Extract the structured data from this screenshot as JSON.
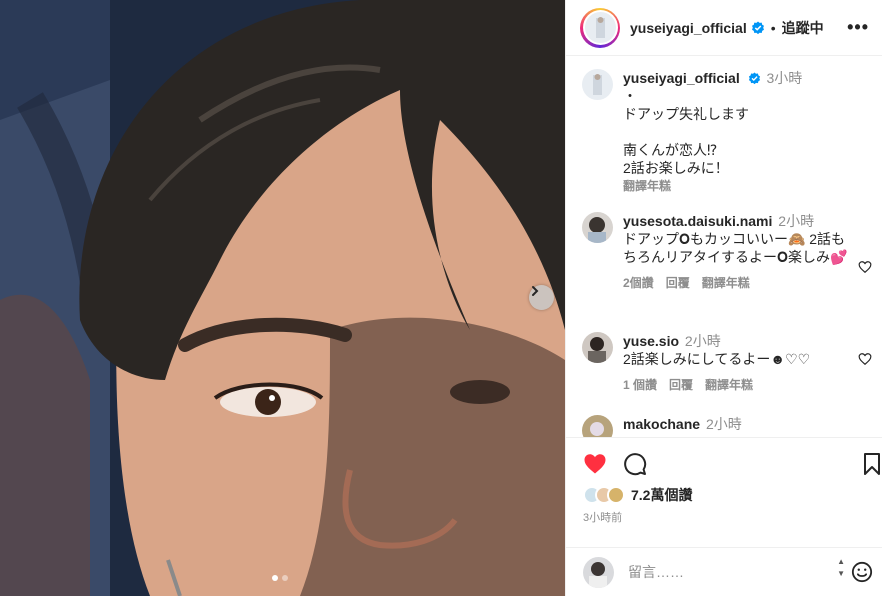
{
  "post": {
    "username": "yuseiyagi_official",
    "follow_status": "追蹤中",
    "separator": "•",
    "more": "•••"
  },
  "caption": {
    "username": "yuseiyagi_official",
    "time": "3小時",
    "lines": [
      "・",
      "ドアップ失礼します",
      "",
      "南くんが恋人⁉︎",
      "2話お楽しみに！"
    ],
    "translate": "翻譯年糕"
  },
  "comments": [
    {
      "username": "yusesota.daisuki.nami",
      "time": "2小時",
      "text": "ドアップ𝐎もカッコいいー🙈 2話もちろんリアタイするよー𝐎楽しみ💕",
      "likes": "2個讚",
      "reply": "回覆",
      "translate": "翻譯年糕"
    },
    {
      "username": "yuse.sio",
      "time": "2小時",
      "text": "2話楽しみにしてるよー☻♡♡",
      "likes": "1 個讚",
      "reply": "回覆",
      "translate": "翻譯年糕"
    },
    {
      "username": "makochane",
      "time": "2小時"
    }
  ],
  "engagement": {
    "likes": "7.2萬個讚",
    "posted": "3小時前"
  },
  "comment_box": {
    "placeholder": "留言……"
  },
  "icons": {
    "next": "chevron-right-icon",
    "verified": "verified-badge-icon",
    "like": "heart-filled-icon",
    "comment": "speech-bubble-icon",
    "save": "bookmark-icon",
    "emoji": "smiley-icon"
  },
  "colors": {
    "like_red": "#ff3040",
    "verified_blue": "#0095f6",
    "muted": "#8e8e8e"
  }
}
